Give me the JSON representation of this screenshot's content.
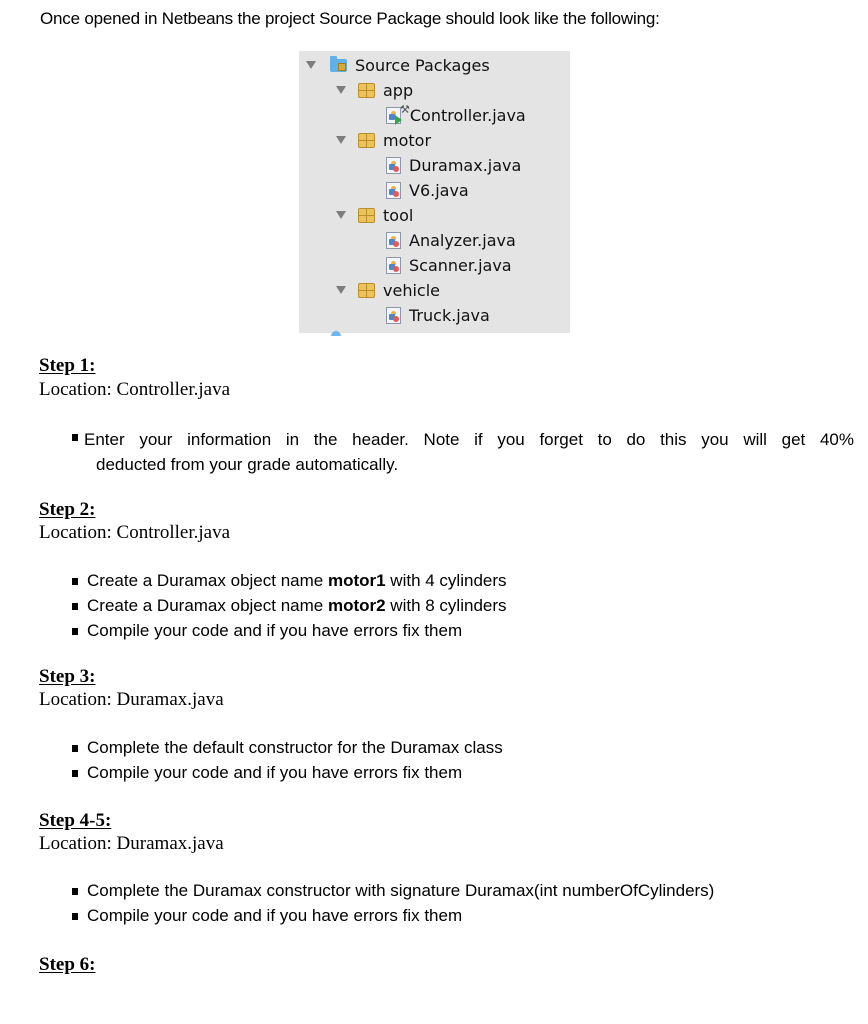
{
  "intro": "Once opened in Netbeans the project Source Package should look like the following:",
  "tree": {
    "root": {
      "label": "Source Packages",
      "icon": "source-folder-icon",
      "expanded": true
    },
    "packages": [
      {
        "label": "app",
        "icon": "package-icon",
        "expanded": true,
        "files": [
          {
            "label": "Controller.java",
            "icon": "main-class-icon",
            "is_main": true
          }
        ]
      },
      {
        "label": "motor",
        "icon": "package-icon",
        "expanded": true,
        "files": [
          {
            "label": "Duramax.java",
            "icon": "java-file-icon"
          },
          {
            "label": "V6.java",
            "icon": "java-file-icon"
          }
        ]
      },
      {
        "label": "tool",
        "icon": "package-icon",
        "expanded": true,
        "files": [
          {
            "label": "Analyzer.java",
            "icon": "java-file-icon"
          },
          {
            "label": "Scanner.java",
            "icon": "java-file-icon"
          }
        ]
      },
      {
        "label": "vehicle",
        "icon": "package-icon",
        "expanded": true,
        "files": [
          {
            "label": "Truck.java",
            "icon": "java-file-icon"
          }
        ]
      }
    ]
  },
  "steps": [
    {
      "title": "Step 1:",
      "location": "Location: Controller.java",
      "bullets": [
        {
          "line1": "Enter your information in the header. Note if you forget to do this you will get 40%",
          "line2": "deducted from your grade automatically."
        }
      ]
    },
    {
      "title": "Step 2:",
      "location": "Location: Controller.java",
      "bullets": [
        {
          "pre": "Create a Duramax object name ",
          "bold": "motor1",
          "post": " with 4 cylinders"
        },
        {
          "pre": "Create a Duramax object name ",
          "bold": "motor2",
          "post": " with 8 cylinders"
        },
        {
          "pre": "Compile your code and if you have errors fix them"
        }
      ]
    },
    {
      "title": "Step 3:",
      "location": "Location: Duramax.java",
      "bullets": [
        {
          "pre": "Complete the default constructor for the Duramax class"
        },
        {
          "pre": "Compile your code and if you have errors fix them"
        }
      ]
    },
    {
      "title": "Step 4-5:",
      "location": "Location: Duramax.java",
      "bullets": [
        {
          "pre": "Complete the Duramax constructor with signature Duramax(int numberOfCylinders)"
        },
        {
          "pre": "Compile your code and if you have errors fix them"
        }
      ]
    },
    {
      "title": "Step 6:"
    }
  ]
}
